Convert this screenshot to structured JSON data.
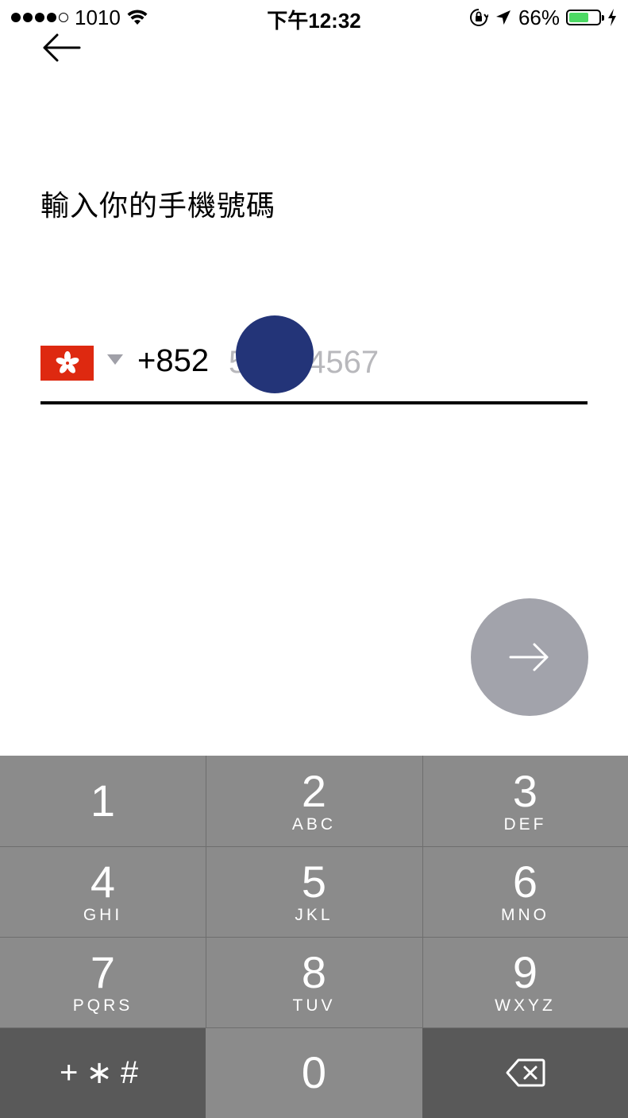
{
  "status_bar": {
    "carrier": "1010",
    "time": "下午12:32",
    "battery": "66%",
    "battery_level": 0.66
  },
  "header": {
    "back_icon": "arrow-left-icon"
  },
  "title": "輸入你的手機號碼",
  "phone": {
    "country_flag": "hong-kong-flag-icon",
    "country_code": "+852",
    "placeholder": "5123 4567",
    "value": ""
  },
  "next_button": {
    "icon": "arrow-right-icon"
  },
  "keypad": {
    "keys": [
      {
        "digit": "1",
        "letters": ""
      },
      {
        "digit": "2",
        "letters": "ABC"
      },
      {
        "digit": "3",
        "letters": "DEF"
      },
      {
        "digit": "4",
        "letters": "GHI"
      },
      {
        "digit": "5",
        "letters": "JKL"
      },
      {
        "digit": "6",
        "letters": "MNO"
      },
      {
        "digit": "7",
        "letters": "PQRS"
      },
      {
        "digit": "8",
        "letters": "TUV"
      },
      {
        "digit": "9",
        "letters": "WXYZ"
      },
      {
        "digit": "0",
        "letters": ""
      }
    ],
    "symbols_label": "+∗#",
    "delete_icon": "backspace-icon"
  },
  "colors": {
    "flag_red": "#de2910",
    "touch_indicator": "#233478",
    "next_button": "#a2a3ab",
    "keypad_light": "#8b8b8b",
    "keypad_dark": "#595959",
    "battery_green": "#4cd964"
  }
}
